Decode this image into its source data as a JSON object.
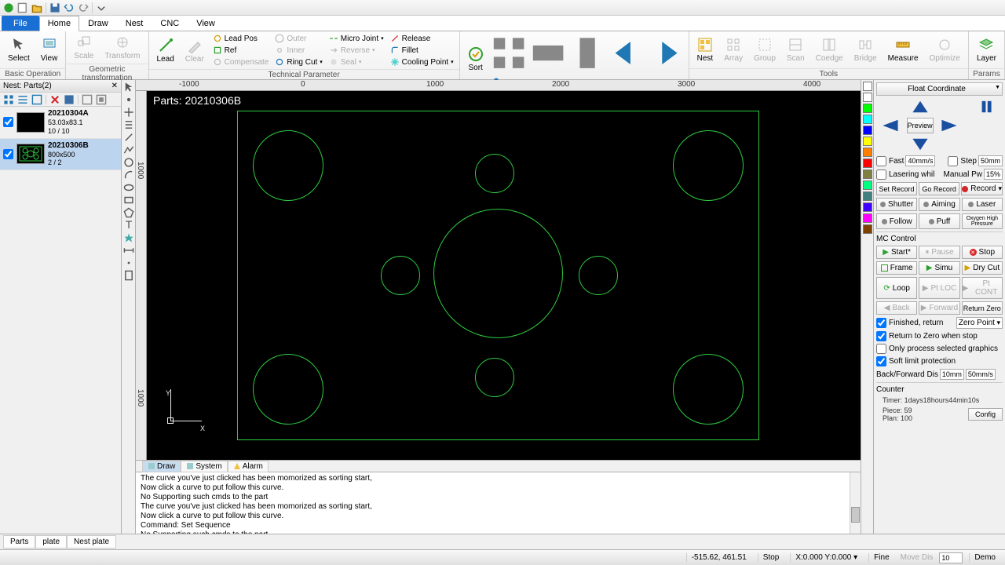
{
  "qat": [
    "app",
    "new",
    "open",
    "sep",
    "save",
    "undo",
    "redo",
    "sep",
    "more"
  ],
  "tabs": {
    "file": "File",
    "items": [
      "Home",
      "Draw",
      "Nest",
      "CNC",
      "View"
    ],
    "active": "Home"
  },
  "ribbon": {
    "groups": [
      {
        "label": "Basic Operation",
        "big": [
          {
            "name": "select",
            "label": "Select"
          },
          {
            "name": "view",
            "label": "View"
          }
        ]
      },
      {
        "label": "Geometric transformation",
        "big": [
          {
            "name": "scale",
            "label": "Scale"
          },
          {
            "name": "transform",
            "label": "Transform"
          }
        ]
      },
      {
        "label": "Technical Parameter",
        "big": [
          {
            "name": "lead",
            "label": "Lead"
          },
          {
            "name": "clear",
            "label": "Clear"
          }
        ],
        "cols": [
          [
            {
              "name": "leadpos",
              "label": "Lead Pos"
            },
            {
              "name": "ref",
              "label": "Ref"
            },
            {
              "name": "compensate",
              "label": "Compensate"
            }
          ],
          [
            {
              "name": "outer",
              "label": "Outer"
            },
            {
              "name": "inner",
              "label": "Inner"
            },
            {
              "name": "ringcut",
              "label": "Ring Cut"
            }
          ],
          [
            {
              "name": "microjoint",
              "label": "Micro Joint"
            },
            {
              "name": "reverse",
              "label": "Reverse"
            },
            {
              "name": "seal",
              "label": "Seal"
            }
          ],
          [
            {
              "name": "release",
              "label": "Release"
            },
            {
              "name": "fillet",
              "label": "Fillet"
            },
            {
              "name": "cooling",
              "label": "Cooling Point"
            }
          ]
        ]
      },
      {
        "label": "Sort",
        "big": [
          {
            "name": "sort",
            "label": "Sort"
          }
        ]
      },
      {
        "label": "Tools",
        "big": [
          {
            "name": "nest",
            "label": "Nest"
          },
          {
            "name": "array",
            "label": "Array"
          },
          {
            "name": "group",
            "label": "Group"
          },
          {
            "name": "scan",
            "label": "Scan"
          },
          {
            "name": "coedge",
            "label": "Coedge"
          },
          {
            "name": "bridge",
            "label": "Bridge"
          },
          {
            "name": "measure",
            "label": "Measure"
          },
          {
            "name": "optimize",
            "label": "Optimize"
          }
        ]
      },
      {
        "label": "Params",
        "big": [
          {
            "name": "layer",
            "label": "Layer"
          }
        ]
      }
    ]
  },
  "left_panel": {
    "title": "Nest: Parts(2)",
    "items": [
      {
        "name": "20210304A",
        "dim": "53.03x83.1",
        "qty": "10 / 10"
      },
      {
        "name": "20210306B",
        "dim": "800x500",
        "qty": "2 / 2"
      }
    ],
    "selected": 1
  },
  "canvas": {
    "title": "Parts: 20210306B",
    "ruler_h": [
      "-1000",
      "0",
      "1000",
      "2000",
      "3000",
      "4000"
    ],
    "ruler_v": [
      "1000",
      "1000"
    ]
  },
  "layer_colors": [
    "#ffffff",
    "#ffffff",
    "#00ff00",
    "#00ffff",
    "#0000ff",
    "#ffff00",
    "#ff8000",
    "#ff0000",
    "#808040",
    "#00ff80",
    "#408080",
    "#4000ff",
    "#ff00ff",
    "#804000"
  ],
  "right": {
    "header": "Float Coordinate",
    "preview": "Preview",
    "fast_label": "Fast",
    "fast_val": "40mm/s",
    "step_label": "Step",
    "step_val": "50mm",
    "lasering": "Lasering whil",
    "manual": "Manual Pw",
    "manual_val": "15%",
    "set_record": "Set Record",
    "go_record": "Go Record",
    "record": "Record",
    "shutter": "Shutter",
    "aiming": "Aiming",
    "laser": "Laser",
    "follow": "Follow",
    "puff": "Puff",
    "oxygen": "Oxygen\nHigh Pressure",
    "mc": "MC Control",
    "start": "Start*",
    "pause": "Pause",
    "stop": "Stop",
    "frame": "Frame",
    "simu": "Simu",
    "drycut": "Dry Cut",
    "loop": "Loop",
    "ptloc": "Pt LOC",
    "ptcont": "Pt CONT",
    "back": "Back",
    "forward": "Forward",
    "retzero": "Return Zero",
    "fin_return": "Finished, return",
    "zero_point": "Zero Point",
    "ret_zero_stop": "Return to Zero when stop",
    "only_sel": "Only process selected graphics",
    "soft_limit": "Soft limit protection",
    "backfwd": "Back/Forward Dis",
    "backfwd_v1": "10mm",
    "backfwd_v2": "50mm/s",
    "counter": "Counter",
    "timer": "Timer: 1days18hours44min10s",
    "piece": "Piece: 59",
    "plan": "Plan: 100",
    "config": "Config"
  },
  "log": {
    "tabs": [
      "Draw",
      "System",
      "Alarm"
    ],
    "active": 0,
    "lines": [
      "The curve you've just clicked has been momorized as sorting start,",
      " Now click a curve to put follow this curve.",
      "No Supporting such cmds to the part",
      "The curve you've just clicked has been momorized as sorting start,",
      " Now click a curve to put follow this curve.",
      "Command: Set Sequence",
      "No Supporting such cmds to the part"
    ]
  },
  "bottom_tabs": [
    "Parts",
    "plate",
    "Nest plate"
  ],
  "status": {
    "coord": "-515.62, 461.51",
    "state": "Stop",
    "xy": "X:0.000 Y:0.000",
    "fine": "Fine",
    "move": "Move Dis",
    "move_val": "10",
    "demo": "Demo"
  }
}
